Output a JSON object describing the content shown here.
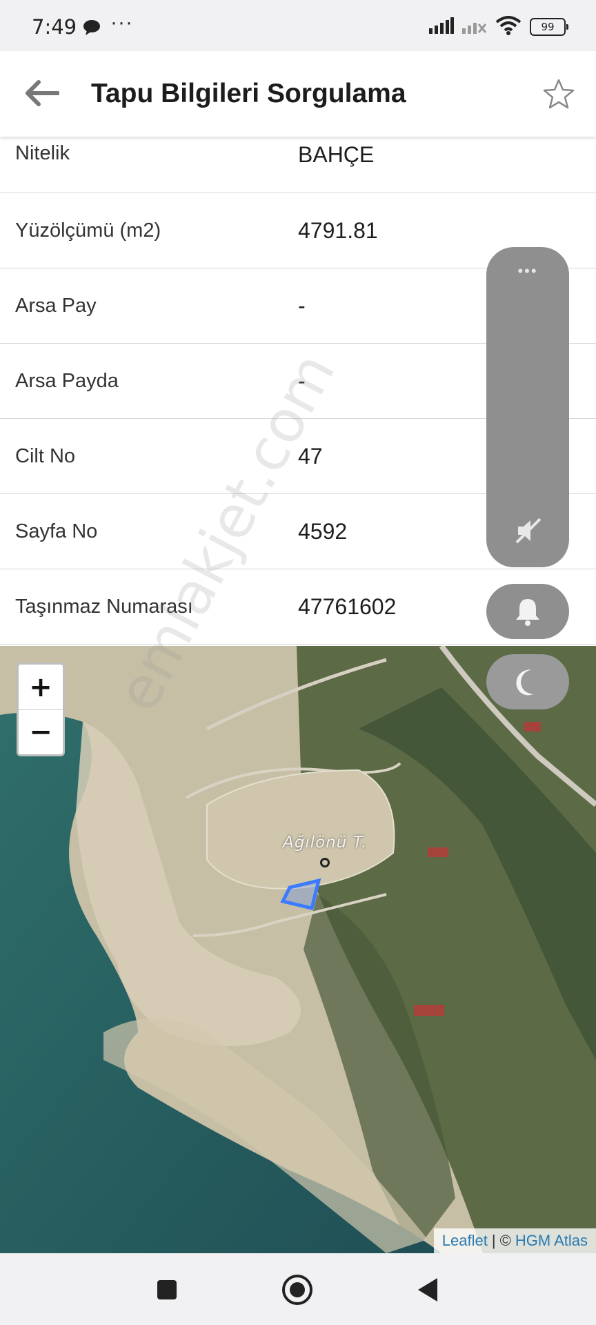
{
  "status_bar": {
    "time": "7:49",
    "more": "···",
    "battery": "99",
    "icons": [
      "chat-icon",
      "signal-icon",
      "signal-2-icon",
      "wifi-icon",
      "battery-icon"
    ]
  },
  "header": {
    "title": "Tapu Bilgileri Sorgulama",
    "back_icon": "arrow-left-icon",
    "favorite_icon": "star-outline-icon"
  },
  "details": [
    {
      "label": "Nitelik",
      "value": "BAHÇE"
    },
    {
      "label": "Yüzölçümü (m2)",
      "value": "4791.81"
    },
    {
      "label": "Arsa Pay",
      "value": "-"
    },
    {
      "label": "Arsa Payda",
      "value": "-"
    },
    {
      "label": "Cilt No",
      "value": "47"
    },
    {
      "label": "Sayfa No",
      "value": "4592"
    },
    {
      "label": "Taşınmaz Numarası",
      "value": "47761602"
    }
  ],
  "map": {
    "zoom_in": "+",
    "zoom_out": "−",
    "place_label": "Ağılönü T.",
    "attribution_link": "Leaflet",
    "attribution_sep": "| ©",
    "attribution_source": "HGM Atlas",
    "parcel_color": "#3a7bff"
  },
  "floating": {
    "dots": "•••",
    "icons": [
      "mute-icon",
      "bell-icon",
      "moon-icon"
    ]
  },
  "watermark": "emlakjet.com",
  "navbar": {
    "icons": [
      "recent-apps-icon",
      "home-icon",
      "back-icon"
    ]
  }
}
